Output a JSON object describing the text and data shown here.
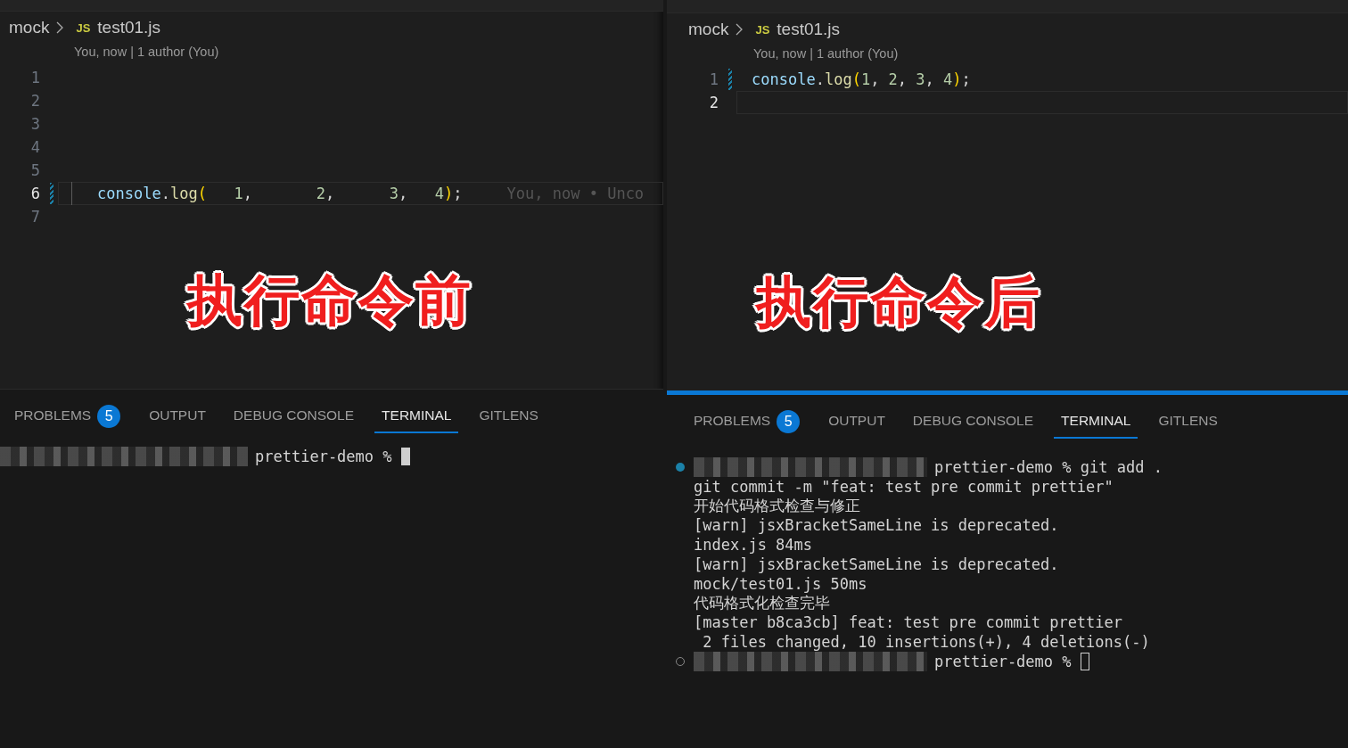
{
  "panes": [
    {
      "breadcrumb": {
        "folder": "mock",
        "file_badge": "JS",
        "file": "test01.js"
      },
      "blame": "You, now | 1 author (You)",
      "lines": [
        {
          "number": "1",
          "current": false,
          "changed": false
        },
        {
          "number": "2",
          "current": false,
          "changed": false
        },
        {
          "number": "3",
          "current": false,
          "changed": false
        },
        {
          "number": "4",
          "current": false,
          "changed": false
        },
        {
          "number": "5",
          "current": false,
          "changed": false
        },
        {
          "number": "6",
          "current": true,
          "changed": true,
          "indent_guide": true,
          "inline_blame": "You, now • Unco",
          "tokens": [
            {
              "kind": "ident",
              "text": "console"
            },
            {
              "kind": "punct",
              "text": "."
            },
            {
              "kind": "fn",
              "text": "log"
            },
            {
              "kind": "paren",
              "text": "("
            },
            {
              "kind": "num",
              "text": "   1"
            },
            {
              "kind": "punct",
              "text": ",       "
            },
            {
              "kind": "num",
              "text": "2"
            },
            {
              "kind": "punct",
              "text": ",      "
            },
            {
              "kind": "num",
              "text": "3"
            },
            {
              "kind": "punct",
              "text": ",   "
            },
            {
              "kind": "num",
              "text": "4"
            },
            {
              "kind": "paren",
              "text": ")"
            },
            {
              "kind": "punct",
              "text": ";"
            }
          ]
        },
        {
          "number": "7",
          "current": false,
          "changed": false
        }
      ],
      "caption": "执行命令前",
      "panel": {
        "focused": false,
        "tabs": [
          {
            "label": "PROBLEMS",
            "badge": "5",
            "selected": false
          },
          {
            "label": "OUTPUT",
            "selected": false
          },
          {
            "label": "DEBUG CONSOLE",
            "selected": false
          },
          {
            "label": "TERMINAL",
            "selected": true
          },
          {
            "label": "GITLENS",
            "selected": false
          }
        ],
        "terminal": [
          {
            "kind": "prompt",
            "text": "prettier-demo %",
            "cursor": true,
            "cursor_filled": true
          }
        ]
      }
    },
    {
      "breadcrumb": {
        "folder": "mock",
        "file_badge": "JS",
        "file": "test01.js"
      },
      "blame": "You, now | 1 author (You)",
      "lines": [
        {
          "number": "1",
          "current": false,
          "changed": true,
          "tokens": [
            {
              "kind": "ident",
              "text": "console"
            },
            {
              "kind": "punct",
              "text": "."
            },
            {
              "kind": "fn",
              "text": "log"
            },
            {
              "kind": "paren",
              "text": "("
            },
            {
              "kind": "num",
              "text": "1"
            },
            {
              "kind": "punct",
              "text": ", "
            },
            {
              "kind": "num",
              "text": "2"
            },
            {
              "kind": "punct",
              "text": ", "
            },
            {
              "kind": "num",
              "text": "3"
            },
            {
              "kind": "punct",
              "text": ", "
            },
            {
              "kind": "num",
              "text": "4"
            },
            {
              "kind": "paren",
              "text": ")"
            },
            {
              "kind": "punct",
              "text": ";"
            }
          ]
        },
        {
          "number": "2",
          "current": true,
          "changed": false
        }
      ],
      "caption": "执行命令后",
      "panel": {
        "focused": true,
        "tabs": [
          {
            "label": "PROBLEMS",
            "badge": "5",
            "selected": false
          },
          {
            "label": "OUTPUT",
            "selected": false
          },
          {
            "label": "DEBUG CONSOLE",
            "selected": false
          },
          {
            "label": "TERMINAL",
            "selected": true
          },
          {
            "label": "GITLENS",
            "selected": false
          }
        ],
        "terminal": [
          {
            "kind": "prompt",
            "status_marker": true,
            "finished": true,
            "text": "prettier-demo % git add ."
          },
          {
            "kind": "output",
            "text": "git commit -m \"feat: test pre commit prettier\""
          },
          {
            "kind": "output",
            "text": "开始代码格式检查与修正"
          },
          {
            "kind": "output",
            "text": "[warn] jsxBracketSameLine is deprecated."
          },
          {
            "kind": "output",
            "text": "index.js 84ms"
          },
          {
            "kind": "output",
            "text": "[warn] jsxBracketSameLine is deprecated."
          },
          {
            "kind": "output",
            "text": "mock/test01.js 50ms"
          },
          {
            "kind": "output",
            "text": "代码格式化检查完毕"
          },
          {
            "kind": "output",
            "text": "[master b8ca3cb] feat: test pre commit prettier"
          },
          {
            "kind": "output",
            "text": " 2 files changed, 10 insertions(+), 4 deletions(-)"
          },
          {
            "kind": "prompt",
            "status_marker": true,
            "finished": false,
            "text": "prettier-demo %",
            "cursor": true,
            "cursor_filled": false
          }
        ]
      }
    }
  ]
}
